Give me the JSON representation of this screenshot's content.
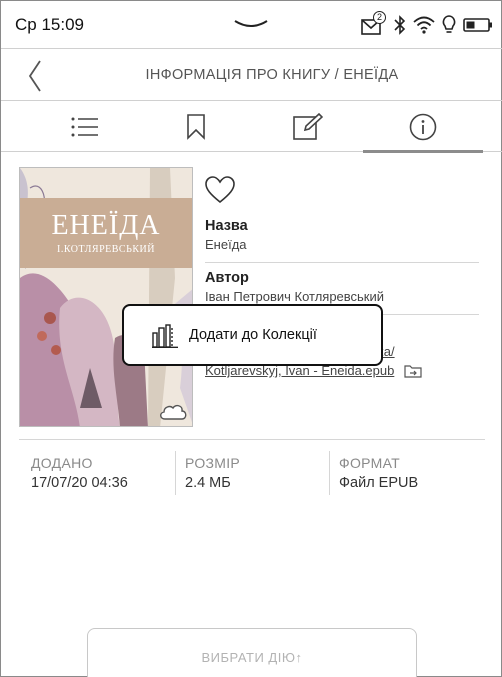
{
  "status_bar": {
    "time": "Ср 15:09",
    "mail_count": "2",
    "icons": [
      "pulldown-chevron-icon",
      "mail-icon",
      "bluetooth-icon",
      "wifi-icon",
      "frontlight-icon",
      "battery-icon"
    ]
  },
  "header": {
    "title": "ІНФОРМАЦІЯ ПРО КНИГУ / ЕНЕЇДА"
  },
  "tabs": [
    {
      "icon": "list-icon",
      "active": false
    },
    {
      "icon": "bookmark-icon",
      "active": false
    },
    {
      "icon": "note-edit-icon",
      "active": false
    },
    {
      "icon": "info-icon",
      "active": true
    }
  ],
  "cover": {
    "title": "ЕНЕЇДА",
    "author": "І.КОТЛЯРЕВСЬКИЙ"
  },
  "details": {
    "name_label": "Назва",
    "name_value": "Енеїда",
    "author_label": "Автор",
    "author_value": "Іван Петрович Котляревський",
    "path_line1": "ька/",
    "path_line2": "Kotljarevskyj, Ivan - Eneida.epub"
  },
  "popup": {
    "label": "Додати до Колекції"
  },
  "meta": {
    "added_label": "ДОДАНО",
    "added_value": "17/07/20 04:36",
    "size_label": "РОЗМІР",
    "size_value": "2.4 МБ",
    "format_label": "ФОРМАТ",
    "format_value": "Файл EPUB"
  },
  "action": {
    "label": "ВИБРАТИ ДІЮ↑"
  },
  "colors": {
    "cover_band": "#c9ad95",
    "active_tab_underline": "#8c8c8c",
    "muted_text": "#8a8a8a"
  }
}
